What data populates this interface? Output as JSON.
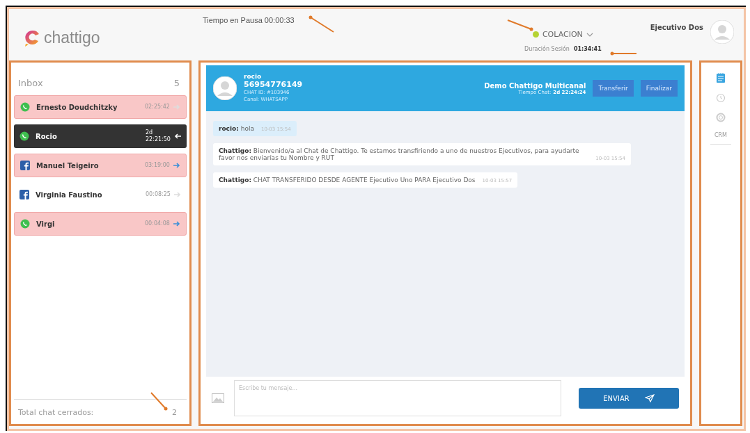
{
  "header": {
    "logo": "chattigo",
    "pause_time": "Tiempo en Pausa 00:00:33",
    "status": {
      "label": "COLACION",
      "color": "#b5d334"
    },
    "session_label": "Duración Sesión",
    "session_time": "01:34:41",
    "user": "Ejecutivo Dos"
  },
  "inbox": {
    "title": "Inbox",
    "count": "5",
    "chats": [
      {
        "name": "Ernesto Doudchitzky",
        "time": "02:25:42",
        "kind": "whatsapp",
        "pending": true,
        "selected": false,
        "transfer": false
      },
      {
        "name": "Rocio",
        "time": "2d 22:21:50",
        "kind": "whatsapp",
        "pending": false,
        "selected": true,
        "transfer": false
      },
      {
        "name": "Manuel Teigeiro",
        "time": "03:19:00",
        "kind": "facebook",
        "pending": true,
        "selected": false,
        "transfer": true
      },
      {
        "name": "Virginia Faustino",
        "time": "00:08:25",
        "kind": "facebook",
        "pending": false,
        "selected": false,
        "transfer": false
      },
      {
        "name": "Virgi",
        "time": "00:04:08",
        "kind": "whatsapp",
        "pending": true,
        "selected": false,
        "transfer": true
      }
    ],
    "closed_label": "Total chat cerrados:",
    "closed_count": "2"
  },
  "chat": {
    "contact": "rocio",
    "phone": "56954776149",
    "chat_id": "CHAT ID: #103946",
    "channel": "Canal: WHATSAPP",
    "company": "Demo Chattigo Multicanal",
    "chat_time_label": "Tiempo Chat:",
    "chat_time": "2d 22:24:24",
    "buttons": [
      "Transferir",
      "Finalizar"
    ],
    "messages": [
      {
        "kind": "client",
        "sender": "rocio:",
        "text": "hola",
        "time": "10-03 15:54"
      },
      {
        "kind": "agent",
        "sender": "Chattigo:",
        "text": "Bienvenido/a al Chat de Chattigo. Te estamos transfiriendo a uno de nuestros Ejecutivos, para ayudarte favor nos enviarías tu Nombre y RUT",
        "time": "10-03 15:54"
      },
      {
        "kind": "agent",
        "sender": "Chattigo:",
        "text": "CHAT TRANSFERIDO DESDE AGENTE Ejecutivo Uno PARA Ejecutivo Dos",
        "time": "10-03 15:57"
      }
    ],
    "input_placeholder": "Escribe tu mensaje...",
    "send_label": "ENVIAR"
  },
  "side_tools": [
    {
      "kind": "notes",
      "selected": true
    },
    {
      "kind": "history",
      "selected": false
    },
    {
      "kind": "help",
      "selected": false
    },
    {
      "kind": "crm",
      "label": "CRM",
      "selected": false
    }
  ]
}
